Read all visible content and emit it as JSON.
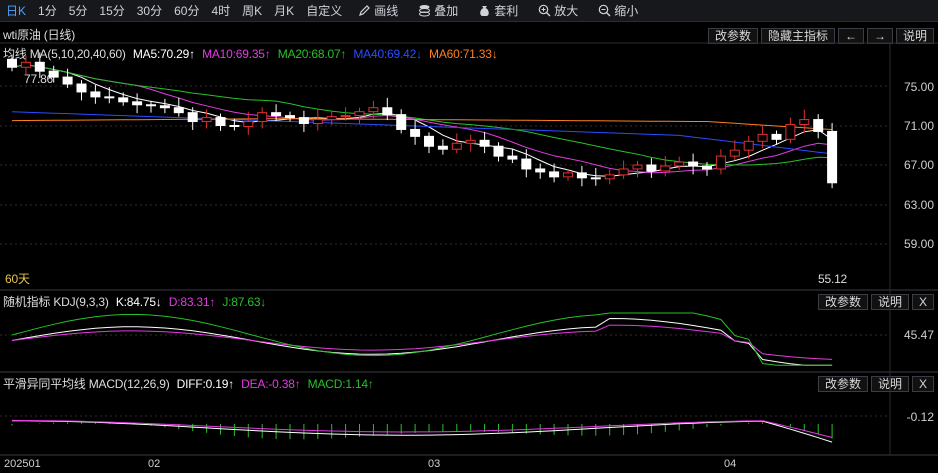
{
  "toolbar": {
    "periods": [
      "日K",
      "1分",
      "5分",
      "15分",
      "30分",
      "60分",
      "4时",
      "周K",
      "月K",
      "自定义"
    ],
    "active_period": "日K",
    "tools": [
      {
        "icon": "pencil-icon",
        "label": "画线"
      },
      {
        "icon": "stack-icon",
        "label": "叠加"
      },
      {
        "icon": "money-bag-icon",
        "label": "套利"
      },
      {
        "icon": "zoom-in-icon",
        "label": "放大"
      },
      {
        "icon": "zoom-out-icon",
        "label": "缩小"
      }
    ]
  },
  "main": {
    "title": "wti原油 (日线)",
    "buttons": [
      "改参数",
      "隐藏主指标",
      "←",
      "→",
      "说明"
    ],
    "legend": {
      "ma_name": "均线 MA(5,10,20,40,60)",
      "ma5": "MA5:70.29↑",
      "ma10": "MA10:69.35↑",
      "ma20": "MA20:68.07↑",
      "ma40": "MA40:69.42↓",
      "ma60": "MA60:71.33↓"
    },
    "high_label": "77.86",
    "low_label": "55.12",
    "range_label": "60天",
    "y_ticks": [
      "75.00",
      "71.00",
      "67.00",
      "63.00",
      "59.00"
    ]
  },
  "kdj": {
    "name": "随机指标 KDJ(9,3,3)",
    "k": "K:84.75↓",
    "d": "D:83.31↑",
    "j": "J:87.63↓",
    "buttons": [
      "改参数",
      "说明",
      "X"
    ],
    "y_tick": "45.47"
  },
  "macd": {
    "name": "平滑异同平均线 MACD(12,26,9)",
    "diff": "DIFF:0.19↑",
    "dea": "DEA:-0.38↑",
    "macd": "MACD:1.14↑",
    "buttons": [
      "改参数",
      "说明",
      "X"
    ],
    "y_tick": "-0.12"
  },
  "x_axis": [
    "202501",
    "02",
    "03",
    "04"
  ],
  "colors": {
    "up": "#e03030",
    "down": "#ffffff",
    "ma5": "#ffffff",
    "ma10": "#e23be2",
    "ma20": "#27c127",
    "ma40": "#2b4dff",
    "ma60": "#ff7f1e",
    "k_line": "#ffffff",
    "d_line": "#e23be2",
    "j_line": "#27c127"
  }
}
